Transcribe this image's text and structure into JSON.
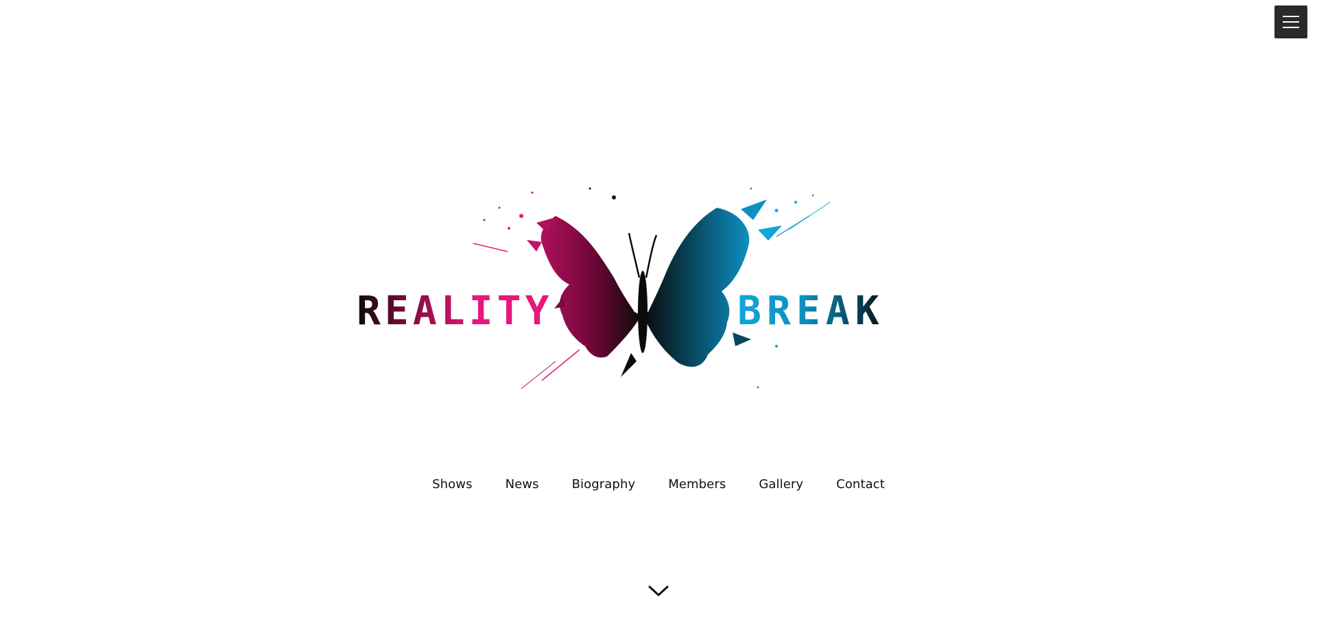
{
  "header": {
    "menu_icon": "hamburger-menu-icon",
    "menu_button_color": "#2a2a2a"
  },
  "logo": {
    "text_left": "REALITY",
    "text_right": "BREAK",
    "butterfly_icon": "butterfly-splash-icon",
    "colors": {
      "magenta": "#e6197a",
      "dark_magenta": "#7a0a3e",
      "cyan": "#10a6dc",
      "dark_cyan": "#07465c",
      "black": "#0b0b0b"
    }
  },
  "nav": {
    "items": [
      {
        "label": "Shows"
      },
      {
        "label": "News"
      },
      {
        "label": "Biography"
      },
      {
        "label": "Members"
      },
      {
        "label": "Gallery"
      },
      {
        "label": "Contact"
      }
    ]
  },
  "scroll": {
    "icon": "chevron-down-icon"
  }
}
